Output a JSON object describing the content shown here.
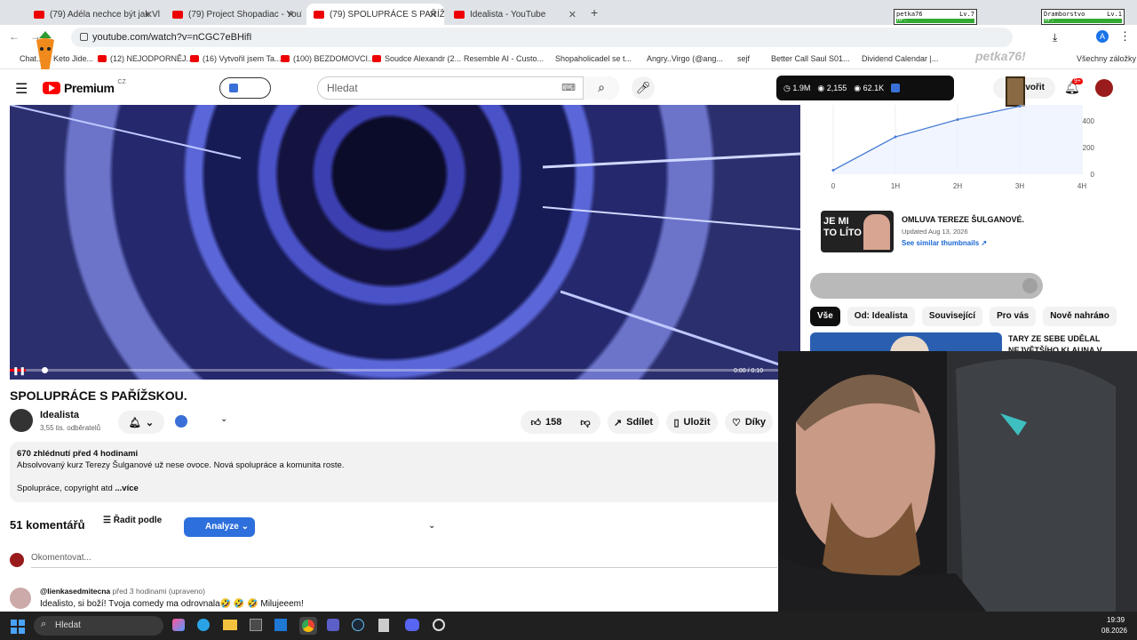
{
  "tabs": [
    {
      "label": "(79) Adéla nechce být jak Vladi..."
    },
    {
      "label": "(79) Project Shopadiac - YouTu..."
    },
    {
      "label": "(79) SPOLUPRÁCE S PAŘÍŽSKOU..."
    },
    {
      "label": "Idealista - YouTube"
    }
  ],
  "overlay_players": [
    {
      "name": "petka76",
      "level": "Lv.7",
      "hp_label": "HP:"
    },
    {
      "name": "Dramborstvo",
      "level": "Lv.1",
      "hp_label": "HP:"
    }
  ],
  "address": {
    "url": "youtube.com/watch?v=nCGC7eBHifI",
    "profile_initial": "A"
  },
  "bookmarks": [
    "Chat...",
    "Keto Jide...",
    "(12) NEJODPORNĚJ...",
    "(16) Vytvořil jsem Ta...",
    "(100) BEZDOMOVCI...",
    "Soudce Alexandr (2...",
    "Resemble AI - Custo...",
    "Shopaholicadel se t...",
    "Angry..Virgo (@ang...",
    "sejf",
    "Better Call Saul S01...",
    "Dividend Calendar |...",
    "Všechny záložky"
  ],
  "watermark_name": "petka76!",
  "header": {
    "logo_label": "Premium",
    "region": "CZ",
    "search_placeholder": "Hledat",
    "create_label": "Vytvořit",
    "notif_count": "9+"
  },
  "stats": {
    "subs": "1.9M",
    "views": "2,155",
    "views2": "62.1K"
  },
  "chart_data": {
    "type": "line",
    "categories": [
      "0",
      "1H",
      "2H",
      "3H",
      "4H"
    ],
    "values": [
      30,
      280,
      410,
      510,
      null
    ],
    "yticks": [
      "0",
      "200",
      "400"
    ],
    "ylim": [
      0,
      520
    ]
  },
  "thumb_card": {
    "thumb_text": "JE MI TO LÍTO",
    "title": "OMLUVA TEREZE ŠULGANOVÉ.",
    "updated": "Updated Aug 13, 2026",
    "link": "See similar thumbnails ↗"
  },
  "chips": [
    "Vše",
    "Od: Idealista",
    "Související",
    "Pro vás",
    "Nově nahráno"
  ],
  "related": [
    {
      "title": "TARY ZE SEBE UDĚLAL NEJVĚTŠÍHO KLAUNA V"
    }
  ],
  "player": {
    "time": "0:00 / 0:10",
    "progress": 0.02
  },
  "video": {
    "title": "SPOLUPRÁCE S PAŘÍŽSKOU.",
    "channel": "Idealista",
    "subscribers": "3,55 tis. odběratelů",
    "likes": "158",
    "share": "Sdílet",
    "save": "Uložit",
    "thanks": "Díky"
  },
  "description": {
    "meta": "670 zhlédnutí  před 4 hodinami",
    "line1": "Absolvovaný kurz Terezy Šulganové už nese ovoce. Nová spolupráce a komunita roste.",
    "line2": "Spolupráce, copyright atd",
    "more": "...více"
  },
  "comments": {
    "count": "51 komentářů",
    "sort": "Řadit podle",
    "analyze": "Analyze",
    "placeholder": "Okomentovat...",
    "first": {
      "author": "@lienkasedmitecna",
      "time": "před 3 hodinami (upraveno)",
      "text": "Idealisto, si boží! Tvoja comedy ma odrovnala🤣 🤣 🤣  Milujeeem!"
    }
  },
  "taskbar": {
    "search": "Hledat",
    "time": "19:39",
    "date": "08.2026"
  }
}
